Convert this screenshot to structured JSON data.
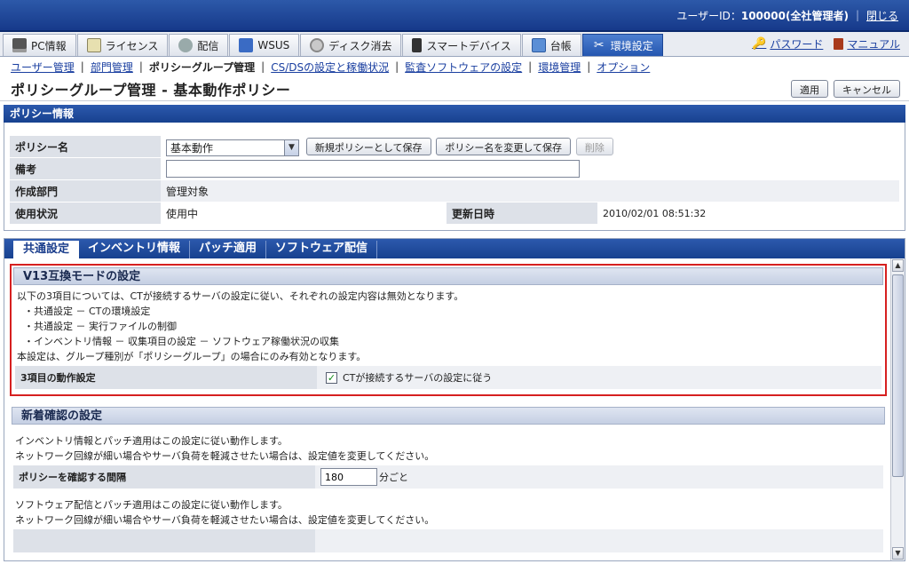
{
  "header": {
    "user_label": "ユーザーID：",
    "user_id": "100000(全社管理者)",
    "logout": "閉じる"
  },
  "nav": {
    "tabs": [
      {
        "label": "PC情報",
        "icon": "pc-icon"
      },
      {
        "label": "ライセンス",
        "icon": "license-icon"
      },
      {
        "label": "配信",
        "icon": "distribution-icon"
      },
      {
        "label": "WSUS",
        "icon": "wsus-icon"
      },
      {
        "label": "ディスク消去",
        "icon": "disk-erase-icon"
      },
      {
        "label": "スマートデバイス",
        "icon": "smart-device-icon"
      },
      {
        "label": "台帳",
        "icon": "ledger-icon"
      },
      {
        "label": "環境設定",
        "icon": "tools-icon"
      }
    ],
    "password": "パスワード",
    "manual": "マニュアル"
  },
  "subnav": {
    "items": [
      "ユーザー管理",
      "部門管理",
      "ポリシーグループ管理",
      "CS/DSの設定と稼働状況",
      "監査ソフトウェアの設定",
      "環境管理",
      "オプション"
    ]
  },
  "page": {
    "title": "ポリシーグループ管理 - 基本動作ポリシー",
    "apply": "適用",
    "cancel": "キャンセル"
  },
  "policy_info": {
    "heading": "ポリシー情報",
    "name_label": "ポリシー名",
    "name_value": "基本動作",
    "save_new": "新規ポリシーとして保存",
    "rename_save": "ポリシー名を変更して保存",
    "delete": "削除",
    "note_label": "備考",
    "note_value": "",
    "dept_label": "作成部門",
    "dept_value": "管理対象",
    "status_label": "使用状況",
    "status_value": "使用中",
    "updated_label": "更新日時",
    "updated_value": "2010/02/01 08:51:32"
  },
  "content_tabs": [
    "共通設定",
    "インベントリ情報",
    "パッチ適用",
    "ソフトウェア配信"
  ],
  "v13": {
    "heading": "V13互換モードの設定",
    "intro": "以下の3項目については、CTが接続するサーバの設定に従い、それぞれの設定内容は無効となります。",
    "items": [
      "・共通設定 － CTの環境設定",
      "・共通設定 － 実行ファイルの制御",
      "・インベントリ情報 － 収集項目の設定 － ソフトウェア稼働状況の収集"
    ],
    "note": "本設定は、グループ種別が「ポリシーグループ」の場合にのみ有効となります。",
    "row_label": "3項目の動作設定",
    "checkbox_label": "CTが接続するサーバの設定に従う",
    "checked": true
  },
  "newcheck": {
    "heading": "新着確認の設定",
    "text1a": "インベントリ情報とパッチ適用はこの設定に従い動作します。",
    "text1b": "ネットワーク回線が細い場合やサーバ負荷を軽減させたい場合は、設定値を変更してください。",
    "interval_label": "ポリシーを確認する間隔",
    "interval_value": "180",
    "interval_unit": "分ごと",
    "text2a": "ソフトウェア配信とパッチ適用はこの設定に従い動作します。",
    "text2b": "ネットワーク回線が細い場合やサーバ負荷を軽減させたい場合は、設定値を変更してください。"
  }
}
